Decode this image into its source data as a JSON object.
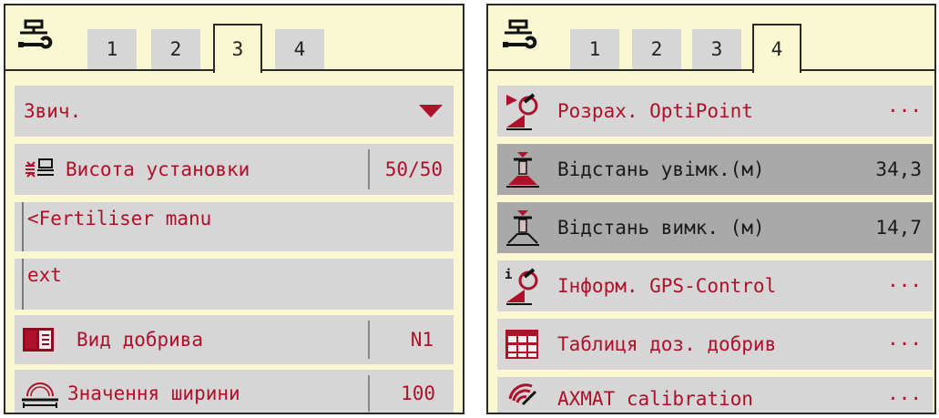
{
  "left_panel": {
    "tabs": [
      "1",
      "2",
      "3",
      "4"
    ],
    "active_tab": "3",
    "dropdown": {
      "value": "Звич.",
      "icon": "dropdown-arrow-icon"
    },
    "mount_height": {
      "label": "Висота установки",
      "value": "50/50",
      "icon": "mount-height-icon"
    },
    "text_line_1": "<Fertiliser manu",
    "text_line_2": "ext",
    "fertiliser_type": {
      "label": "Вид добрива",
      "value": "N1",
      "icon": "fertiliser-book-icon"
    },
    "width_value": {
      "label": "Значення ширини",
      "value": "100",
      "icon": "spread-width-icon"
    }
  },
  "right_panel": {
    "tabs": [
      "1",
      "2",
      "3",
      "4"
    ],
    "active_tab": "4",
    "items": [
      {
        "label": "Розрах. OptiPoint",
        "value": "···",
        "icon": "optipoint-icon",
        "highlight": false
      },
      {
        "label": "Відстань увімк.(м)",
        "value": "34,3",
        "icon": "distance-on-icon",
        "highlight": true
      },
      {
        "label": "Відстань вимк. (м)",
        "value": "14,7",
        "icon": "distance-off-icon",
        "highlight": true
      },
      {
        "label": "Інформ. GPS-Control",
        "value": "···",
        "icon": "gps-info-icon",
        "highlight": false
      },
      {
        "label": "Таблиця доз. добрив",
        "value": "···",
        "icon": "fertiliser-table-icon",
        "highlight": false
      },
      {
        "label": "AXMAT calibration",
        "value": "···",
        "icon": "axmat-calibration-icon",
        "highlight": false
      }
    ]
  },
  "colors": {
    "panel_bg": "#faf8d2",
    "row_bg": "#d6d6d6",
    "row_selected_bg": "#a9a9a9",
    "accent_red": "#b0102a",
    "text_dark": "#1a1a1a"
  }
}
